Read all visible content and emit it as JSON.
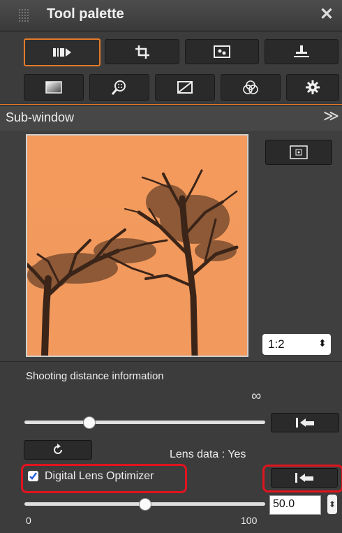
{
  "window": {
    "title": "Tool palette",
    "close_glyph": "✕"
  },
  "tabs_row1": [
    {
      "icon": "basic-adjust-icon",
      "selected": true
    },
    {
      "icon": "crop-icon",
      "selected": false
    },
    {
      "icon": "dust-delete-icon",
      "selected": false
    },
    {
      "icon": "stamp-icon",
      "selected": false
    }
  ],
  "tabs_row2": [
    {
      "icon": "tone-icon",
      "selected": false
    },
    {
      "icon": "detail-zoom-icon",
      "selected": false
    },
    {
      "icon": "curve-icon",
      "selected": false
    },
    {
      "icon": "color-icon",
      "selected": false
    },
    {
      "icon": "settings-gear-icon",
      "selected": false
    }
  ],
  "subwindow": {
    "label": "Sub-window",
    "collapse_glyph": "≫"
  },
  "zoom": {
    "value": "1:2",
    "spinner": "⬍"
  },
  "shooting_distance": {
    "label": "Shooting distance information",
    "infinity_label": "∞",
    "slider_level": 0.27
  },
  "lens": {
    "lens_data_text": "Lens data : Yes"
  },
  "dlo": {
    "checkbox_label": "Digital Lens Optimizer",
    "checked": true,
    "slider_level": 0.5,
    "value": "50.0",
    "min_label": "0",
    "max_label": "100"
  },
  "colors": {
    "accent_orange": "#e57a2a",
    "highlight_red": "#e0141e",
    "photo_sky": "#f49a5a"
  }
}
